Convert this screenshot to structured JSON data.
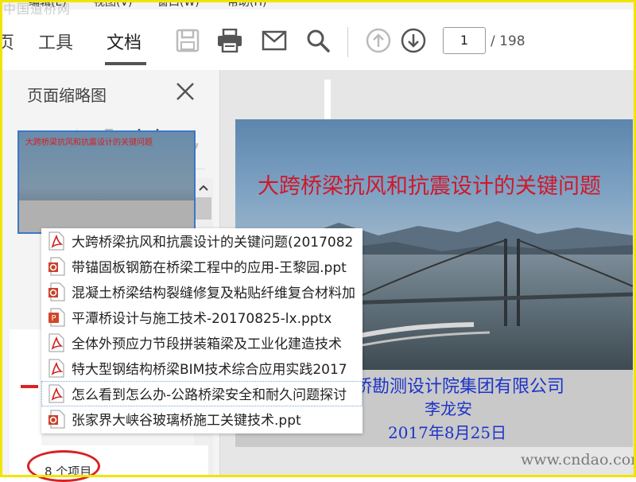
{
  "menubar": {
    "items": [
      "编辑(E)",
      "视图(V)",
      "窗口(W)",
      "帮助(H)"
    ]
  },
  "watermark_top": "中国道桥网",
  "toolbar": {
    "tab_partial": "页",
    "tab_tools": "工具",
    "tab_document": "文档",
    "page_current": "1",
    "page_total": "/ 198"
  },
  "sidebar": {
    "title": "页面缩略图",
    "thumb_title": "大跨桥梁抗风和抗震设计的关键问题"
  },
  "slide": {
    "title": "大跨桥梁抗风和抗震设计的关键问题",
    "org": "桥勘测设计院集团有限公司",
    "author": "李龙安",
    "date": "2017年8月25日"
  },
  "file_list": [
    {
      "name": "大跨桥梁抗风和抗震设计的关键问题(2017082",
      "type": "pdf"
    },
    {
      "name": "带锚固板钢筋在桥梁工程中的应用-王黎园.ppt",
      "type": "ppt"
    },
    {
      "name": "混凝土桥梁结构裂缝修复及粘贴纤维复合材料加",
      "type": "ppt"
    },
    {
      "name": "平潭桥设计与施工技术-20170825-lx.pptx",
      "type": "pptx"
    },
    {
      "name": "全体外预应力节段拼装箱梁及工业化建造技术",
      "type": "pdf"
    },
    {
      "name": "特大型钢结构桥梁BIM技术综合应用实践2017",
      "type": "pdf"
    },
    {
      "name": "怎么看到怎么办-公路桥梁安全和耐久问题探讨",
      "type": "pdf"
    },
    {
      "name": "张家界大峡谷玻璃桥施工关键技术.ppt",
      "type": "ppt"
    }
  ],
  "item_count": "8 个项目",
  "watermark_bottom": "www.cndao.com",
  "colors": {
    "frame": "#f2e400",
    "slide_title": "#d0182a",
    "slide_blue": "#1d34c8",
    "pdf_red": "#d42020"
  }
}
